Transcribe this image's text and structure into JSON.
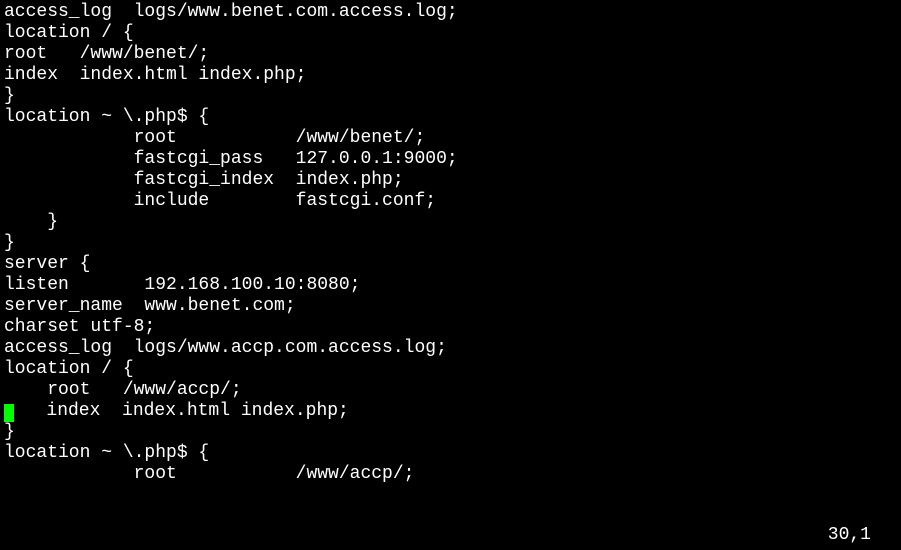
{
  "lines": [
    "access_log  logs/www.benet.com.access.log;",
    "location / {",
    "root   /www/benet/;",
    "index  index.html index.php;",
    "}",
    "location ~ \\.php$ {",
    "            root           /www/benet/;",
    "            fastcgi_pass   127.0.0.1:9000;",
    "            fastcgi_index  index.php;",
    "            include        fastcgi.conf;",
    "    }",
    "",
    "}",
    "server {",
    "listen       192.168.100.10:8080;",
    "server_name  www.benet.com;",
    "charset utf-8;",
    "access_log  logs/www.accp.com.access.log;",
    "location / {",
    "    root   /www/accp/;",
    "    index  index.html index.php;",
    "}",
    "location ~ \\.php$ {",
    "            root           /www/accp/;"
  ],
  "cursor_line_index": 20,
  "status_position": "30,1"
}
